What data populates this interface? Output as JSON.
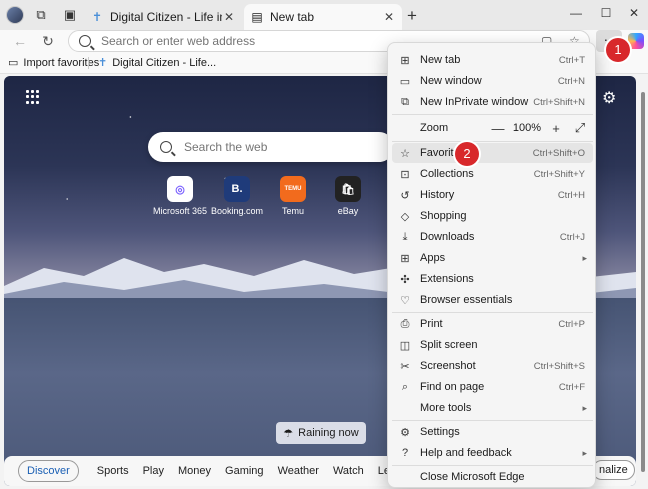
{
  "tabs": [
    {
      "title": "Digital Citizen - Life in a digital w",
      "close": "✕"
    },
    {
      "title": "New tab",
      "close": "✕"
    }
  ],
  "window": {
    "new_tab": "+",
    "minimize": "—",
    "maximize": "☐",
    "close": "✕"
  },
  "address": {
    "placeholder": "Search or enter web address"
  },
  "favorites_bar": {
    "items": [
      "Import favorites",
      "Digital Citizen - Life..."
    ]
  },
  "newtab": {
    "search_placeholder": "Search the web",
    "quick_links": [
      {
        "label": "Microsoft 365",
        "tile": "◎",
        "color": "#7b61ff"
      },
      {
        "label": "Booking.com",
        "tile": "B.",
        "color": "#1f3b7a"
      },
      {
        "label": "Temu",
        "tile": "TEMU",
        "color": "#f26b1d"
      },
      {
        "label": "eBay",
        "tile": "🛍",
        "color": "#222222"
      }
    ],
    "weather": "Raining now",
    "categories": [
      "Discover",
      "Sports",
      "Play",
      "Money",
      "Gaming",
      "Weather",
      "Watch",
      "Learning"
    ],
    "personalize": "nalize"
  },
  "menu": {
    "items": [
      {
        "label": "New tab",
        "shortcut": "Ctrl+T",
        "icon": "new-tab-icon",
        "glyph": "⊞"
      },
      {
        "label": "New window",
        "shortcut": "Ctrl+N",
        "icon": "new-window-icon",
        "glyph": "▭"
      },
      {
        "label": "New InPrivate window",
        "shortcut": "Ctrl+Shift+N",
        "icon": "inprivate-icon",
        "glyph": "⧉"
      },
      {
        "label": "Favorites",
        "shortcut": "Ctrl+Shift+O",
        "icon": "star-icon",
        "glyph": "☆"
      },
      {
        "label": "Collections",
        "shortcut": "Ctrl+Shift+Y",
        "icon": "collections-icon",
        "glyph": "⊡"
      },
      {
        "label": "History",
        "shortcut": "Ctrl+H",
        "icon": "history-icon",
        "glyph": "↺"
      },
      {
        "label": "Shopping",
        "shortcut": "",
        "icon": "tag-icon",
        "glyph": "◇"
      },
      {
        "label": "Downloads",
        "shortcut": "Ctrl+J",
        "icon": "download-icon",
        "glyph": "⤓"
      },
      {
        "label": "Apps",
        "shortcut": "",
        "icon": "apps-icon",
        "glyph": "⊞",
        "submenu": true
      },
      {
        "label": "Extensions",
        "shortcut": "",
        "icon": "puzzle-icon",
        "glyph": "✣"
      },
      {
        "label": "Browser essentials",
        "shortcut": "",
        "icon": "heart-pulse-icon",
        "glyph": "♡"
      },
      {
        "label": "Print",
        "shortcut": "Ctrl+P",
        "icon": "printer-icon",
        "glyph": "⎙"
      },
      {
        "label": "Split screen",
        "shortcut": "",
        "icon": "split-screen-icon",
        "glyph": "◫"
      },
      {
        "label": "Screenshot",
        "shortcut": "Ctrl+Shift+S",
        "icon": "scissors-icon",
        "glyph": "✂"
      },
      {
        "label": "Find on page",
        "shortcut": "Ctrl+F",
        "icon": "find-icon",
        "glyph": "⌕"
      },
      {
        "label": "More tools",
        "shortcut": "",
        "icon": "",
        "glyph": "",
        "submenu": true
      },
      {
        "label": "Settings",
        "shortcut": "",
        "icon": "gear-icon",
        "glyph": "⚙"
      },
      {
        "label": "Help and feedback",
        "shortcut": "",
        "icon": "help-icon",
        "glyph": "?",
        "submenu": true
      },
      {
        "label": "Close Microsoft Edge",
        "shortcut": "",
        "icon": "",
        "glyph": ""
      }
    ],
    "zoom": {
      "label": "Zoom",
      "minus": "—",
      "value": "100%",
      "plus": "+",
      "fullscreen": "⤢"
    },
    "submenu_arrow": "▸"
  },
  "annotations": {
    "step1": "1",
    "step2": "2"
  }
}
